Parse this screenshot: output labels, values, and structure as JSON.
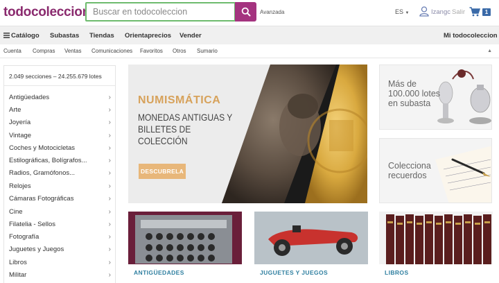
{
  "header": {
    "logo": "todocoleccion",
    "search_placeholder": "Buscar en todocoleccion",
    "advanced": "Avanzada",
    "language": "ES",
    "username": "Izangc",
    "logout": "Salir",
    "cart_count": "1"
  },
  "mainnav": [
    {
      "label": "Catálogo"
    },
    {
      "label": "Subastas"
    },
    {
      "label": "Tiendas"
    },
    {
      "label": "Orientaprecios"
    },
    {
      "label": "Vender"
    },
    {
      "label": "Mi todocoleccion"
    }
  ],
  "subnav": [
    "Cuenta",
    "Compras",
    "Ventas",
    "Comunicaciones",
    "Favoritos",
    "Otros",
    "Sumario"
  ],
  "sidebar": {
    "count": "2.049 secciones – 24.255.679 lotes",
    "items": [
      "Antigüedades",
      "Arte",
      "Joyería",
      "Vintage",
      "Coches y Motocicletas",
      "Estilográficas, Bolígrafos...",
      "Radios, Gramófonos...",
      "Relojes",
      "Cámaras Fotográficas",
      "Cine",
      "Filatelia - Sellos",
      "Fotografía",
      "Juguetes y Juegos",
      "Libros",
      "Militar"
    ]
  },
  "banner": {
    "title": "NUMISMÁTICA",
    "subtitle": "MONEDAS ANTIGUAS Y BILLETES DE COLECCIÓN",
    "button": "DESCUBRELA"
  },
  "promos": [
    {
      "text": "Más de 100.000 lotes en subasta"
    },
    {
      "text": "Colecciona recuerdos"
    }
  ],
  "cards": [
    {
      "label": "ANTIGÜEDADES"
    },
    {
      "label": "JUGUETES Y JUEGOS"
    },
    {
      "label": "LIBROS"
    }
  ],
  "colors": {
    "brand": "#8a2a6e",
    "search_button": "#a4337f",
    "accent_gold": "#d7a25b",
    "link_blue": "#2f7fa0"
  }
}
